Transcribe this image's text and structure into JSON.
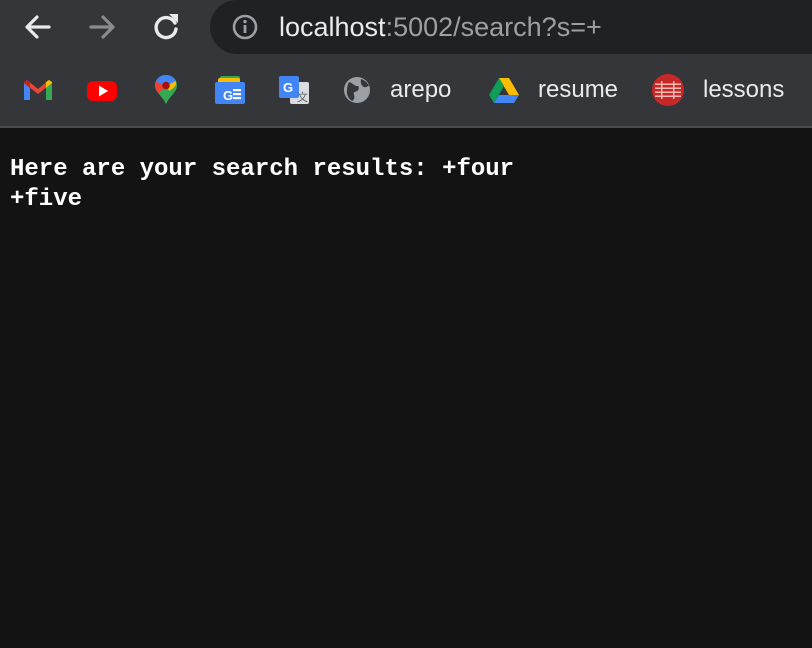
{
  "browser": {
    "url_host": "localhost",
    "url_rest": ":5002/search?s=+"
  },
  "bookmarks": [
    {
      "icon": "gmail-icon"
    },
    {
      "icon": "youtube-icon"
    },
    {
      "icon": "google-maps-icon"
    },
    {
      "icon": "google-news-icon"
    },
    {
      "icon": "google-translate-icon"
    },
    {
      "icon": "globe-icon",
      "label": "arepo"
    },
    {
      "icon": "google-drive-icon",
      "label": "resume"
    },
    {
      "icon": "lessons-icon",
      "label": "lessons"
    }
  ],
  "page": {
    "line1": "Here are your search results: +four",
    "line2": "+five"
  }
}
